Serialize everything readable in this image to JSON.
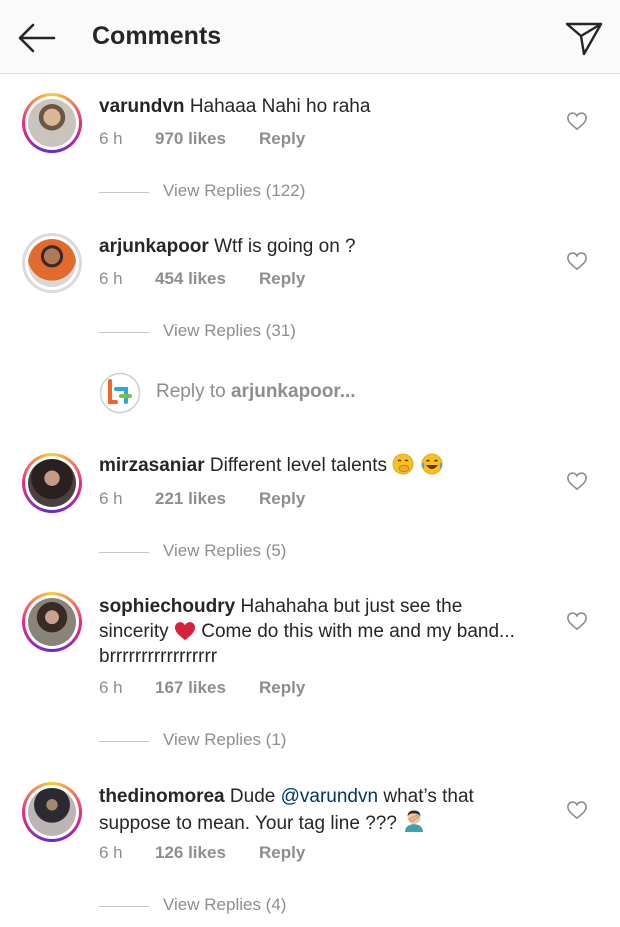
{
  "header": {
    "title": "Comments"
  },
  "comments": [
    {
      "username": "varundvn",
      "text": "Hahaaa Nahi ho raha",
      "time": "6 h",
      "likes": "970 likes",
      "reply": "Reply",
      "view_replies": "View Replies (122)"
    },
    {
      "username": "arjunkapoor",
      "text": "Wtf is going on ?",
      "time": "6 h",
      "likes": "454 likes",
      "reply": "Reply",
      "view_replies": "View Replies (31)"
    },
    {
      "username": "mirzasaniar",
      "text": "Different level talents",
      "time": "6 h",
      "likes": "221 likes",
      "reply": "Reply",
      "view_replies": "View Replies (5)"
    },
    {
      "username": "sophiechoudry",
      "text": "Hahahaha but just see the sincerity",
      "text2": "Come do this with me and my band... brrrrrrrrrrrrrrrrr",
      "time": "6 h",
      "likes": "167 likes",
      "reply": "Reply",
      "view_replies": "View Replies (1)"
    },
    {
      "username": "thedinomorea",
      "text_pre": "Dude",
      "mention": "@varundvn",
      "text_post": "what’s that suppose to mean. Your tag line ???",
      "time": "6 h",
      "likes": "126 likes",
      "reply": "Reply",
      "view_replies": "View Replies (4)"
    }
  ],
  "reply_input": {
    "prefix": "Reply to",
    "target": "arjunkapoor..."
  },
  "icons": {
    "back": "arrow-left-icon",
    "send": "paper-plane-icon",
    "like": "heart-outline-icon",
    "emoji_3": [
      "hand-over-mouth-emoji",
      "tears-of-joy-emoji"
    ],
    "emoji_4": "red-heart-emoji",
    "emoji_5": "facepalm-emoji"
  },
  "colors": {
    "accent": "#003569",
    "muted": "#8e8e8e",
    "heart": "#e0245e"
  }
}
